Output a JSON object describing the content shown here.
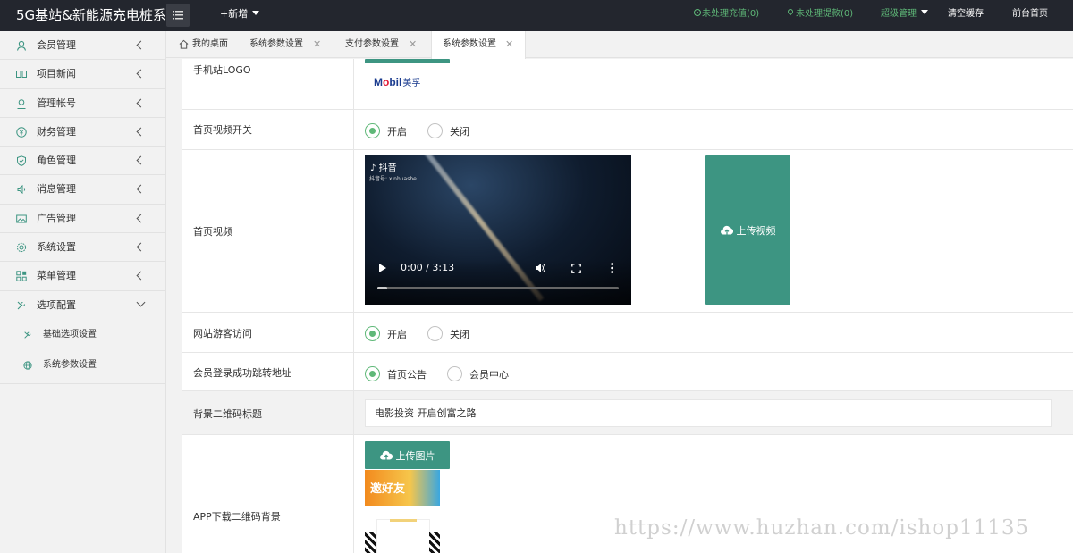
{
  "header": {
    "brand": "5G基站&新能源充电桩系",
    "add_label": "+新增",
    "pending_recharge": "未处理充值(0)",
    "pending_withdraw": "未处理提款(0)",
    "admin_label": "超级管理",
    "clear_cache": "清空缓存",
    "frontend_home": "前台首页",
    "accent_color": "#5fb878"
  },
  "sidebar": {
    "items": [
      {
        "label": "会员管理",
        "icon": "user-icon"
      },
      {
        "label": "项目新闻",
        "icon": "book-icon"
      },
      {
        "label": "管理帐号",
        "icon": "account-icon"
      },
      {
        "label": "财务管理",
        "icon": "yen-icon"
      },
      {
        "label": "角色管理",
        "icon": "shield-icon"
      },
      {
        "label": "消息管理",
        "icon": "speaker-icon"
      },
      {
        "label": "广告管理",
        "icon": "picture-icon"
      },
      {
        "label": "系统设置",
        "icon": "gear-icon"
      },
      {
        "label": "菜单管理",
        "icon": "grid-icon"
      },
      {
        "label": "选项配置",
        "icon": "tool-icon"
      }
    ],
    "sub_items": [
      {
        "label": "基础选项设置",
        "icon": "tool-icon"
      },
      {
        "label": "系统参数设置",
        "icon": "globe-icon"
      }
    ]
  },
  "tabs": [
    {
      "label": "我的桌面"
    },
    {
      "label": "系统参数设置"
    },
    {
      "label": "支付参数设置"
    },
    {
      "label": "系统参数设置"
    }
  ],
  "form": {
    "mobile_logo_label": "手机站LOGO",
    "logo_brand_text": "Mobil",
    "logo_cn_text": "美孚",
    "home_video_switch_label": "首页视频开关",
    "opt_on": "开启",
    "opt_off": "关闭",
    "home_video_label": "首页视频",
    "video_overlay_brand": "抖音",
    "video_overlay_id": "抖音号: xinhuashe",
    "video_time": "0:00 / 3:13",
    "video_progress_fraction": 0.04,
    "upload_video": "上传视频",
    "guest_access_label": "网站游客访问",
    "login_redirect_label": "会员登录成功跳转地址",
    "opt_notice": "首页公告",
    "opt_member_center": "会员中心",
    "qr_title_label": "背景二维码标题",
    "qr_title_value": "电影投资 开启创富之路",
    "app_qr_bg_label": "APP下载二维码背景",
    "upload_image": "上传图片",
    "thumb_title": "邀好友"
  },
  "watermark": "https://www.huzhan.com/ishop11135"
}
